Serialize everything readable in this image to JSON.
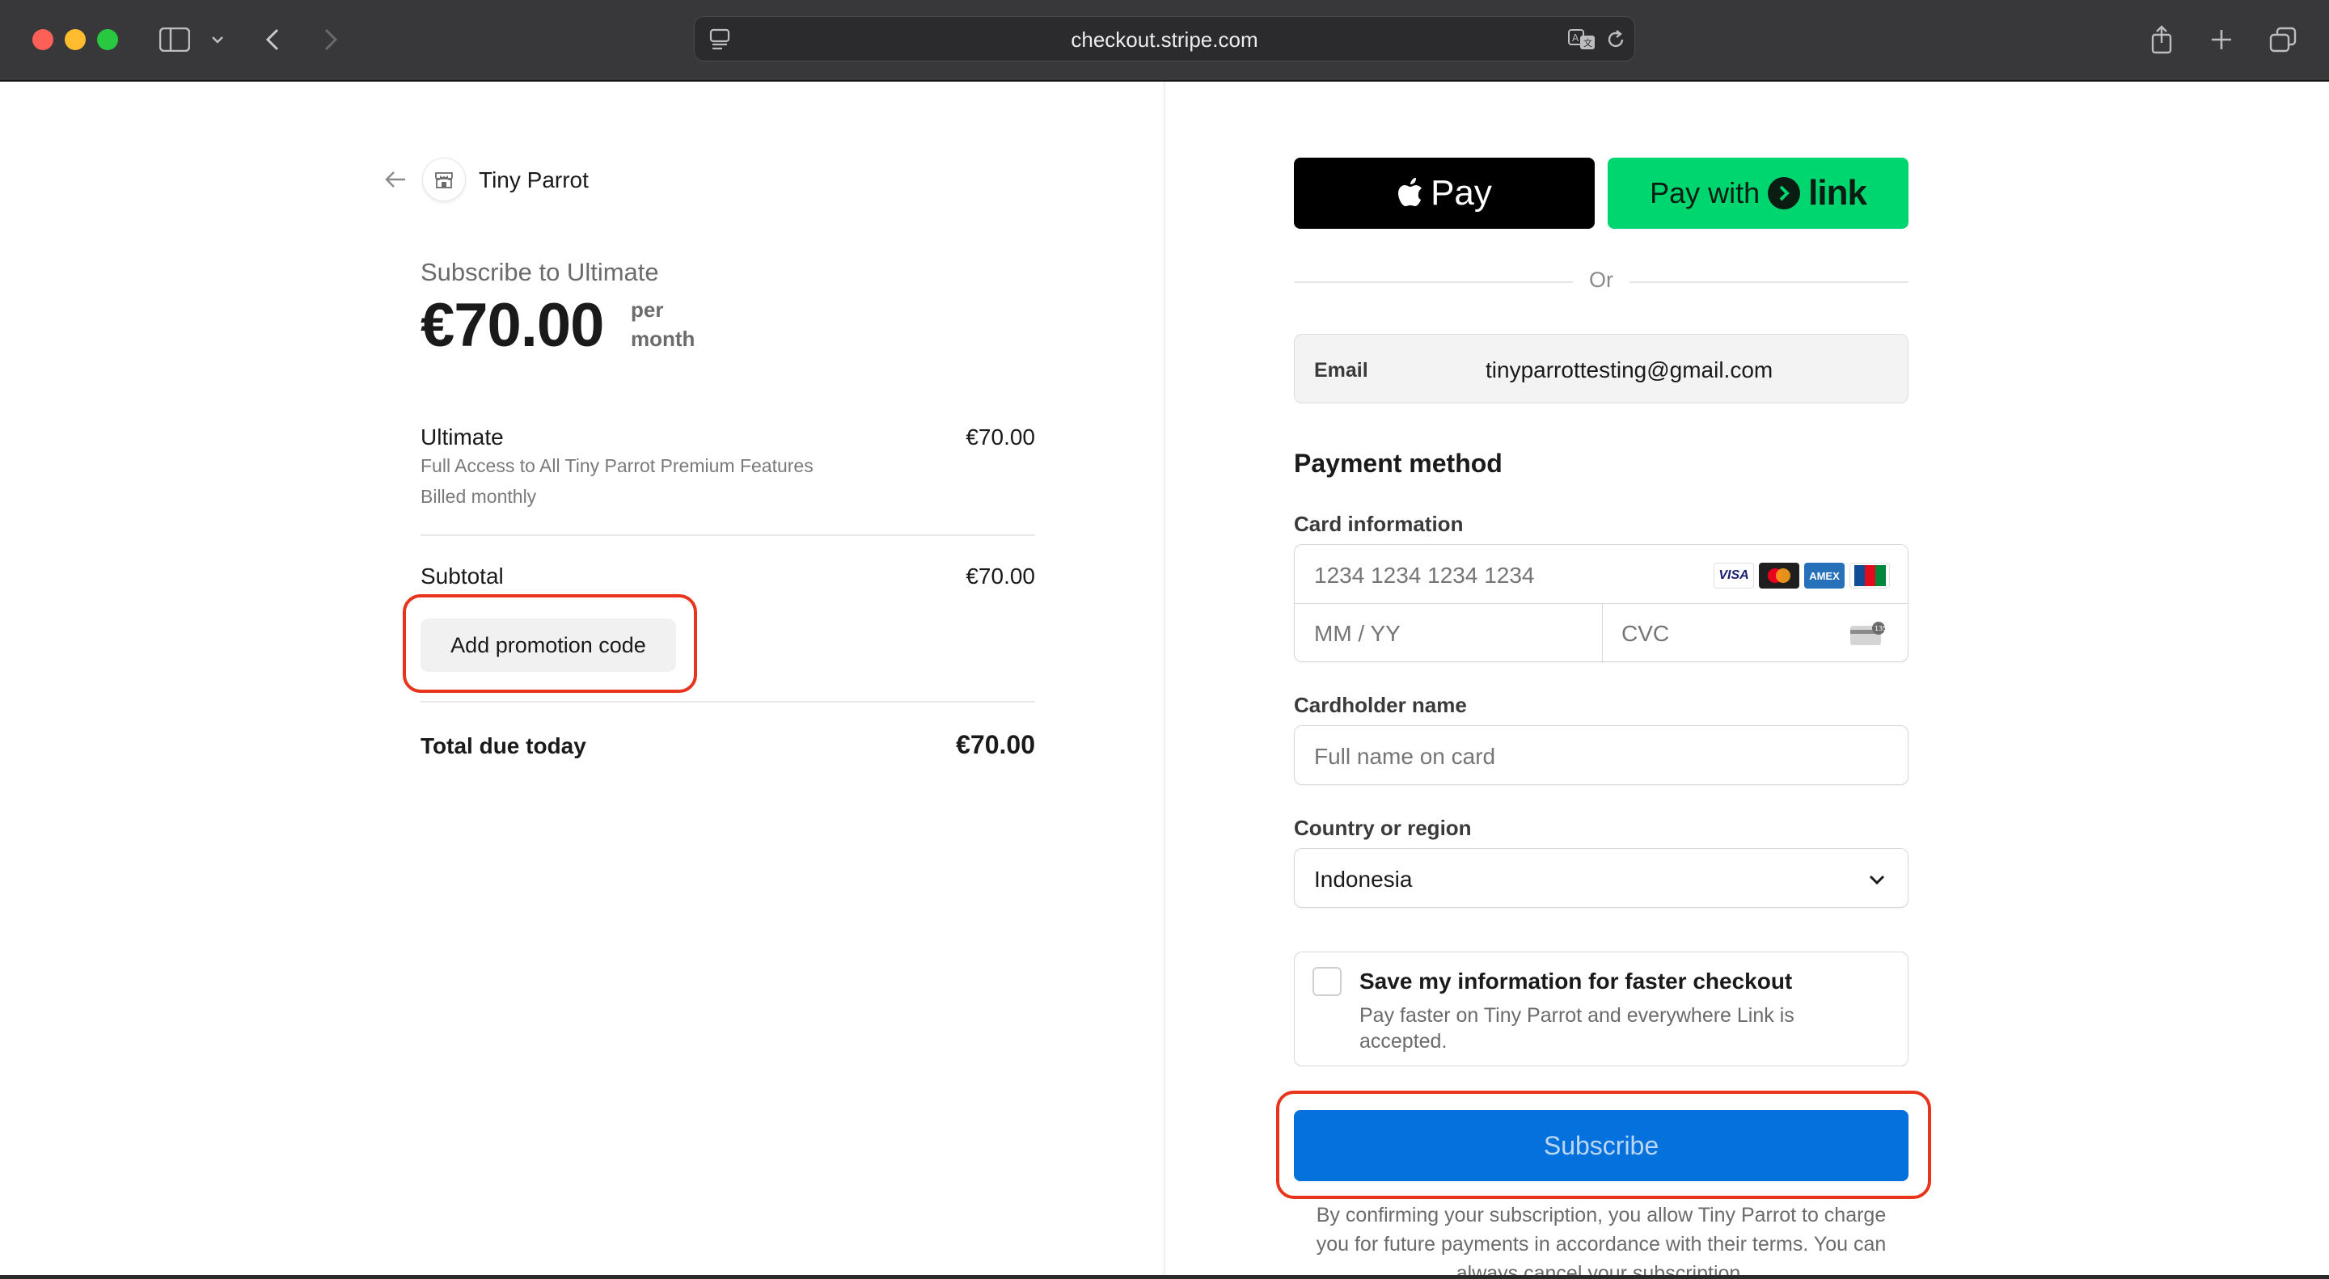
{
  "browser": {
    "url": "checkout.stripe.com"
  },
  "merchant": {
    "name": "Tiny Parrot"
  },
  "summary": {
    "subscribe_title": "Subscribe to Ultimate",
    "price": "€70.00",
    "period_line1": "per",
    "period_line2": "month",
    "line_item": {
      "name": "Ultimate",
      "price": "€70.00",
      "description": "Full Access to All Tiny Parrot Premium Features",
      "billing": "Billed monthly"
    },
    "subtotal_label": "Subtotal",
    "subtotal_value": "€70.00",
    "promo_label": "Add promotion code",
    "total_label": "Total due today",
    "total_value": "€70.00"
  },
  "express": {
    "apple_pay_label": "Pay",
    "link_prefix": "Pay with",
    "link_word": "link",
    "or_label": "Or"
  },
  "email": {
    "label": "Email",
    "value": "tinyparrottesting@gmail.com"
  },
  "payment": {
    "title": "Payment method",
    "card_label": "Card information",
    "card_number_placeholder": "1234 1234 1234 1234",
    "expiry_placeholder": "MM / YY",
    "cvc_placeholder": "CVC",
    "brands": [
      "VISA",
      "mastercard",
      "AMEX",
      "JCB"
    ],
    "cardholder_label": "Cardholder name",
    "cardholder_placeholder": "Full name on card",
    "country_label": "Country or region",
    "country_value": "Indonesia"
  },
  "save_info": {
    "title": "Save my information for faster checkout",
    "description": "Pay faster on Tiny Parrot and everywhere Link is accepted."
  },
  "subscribe_label": "Subscribe",
  "legal_text": "By confirming your subscription, you allow Tiny Parrot to charge you for future payments in accordance with their terms. You can always cancel your subscription.",
  "colors": {
    "highlight": "#e8341c",
    "subscribe_bg": "#0571dc",
    "link_green": "#00d66f"
  }
}
